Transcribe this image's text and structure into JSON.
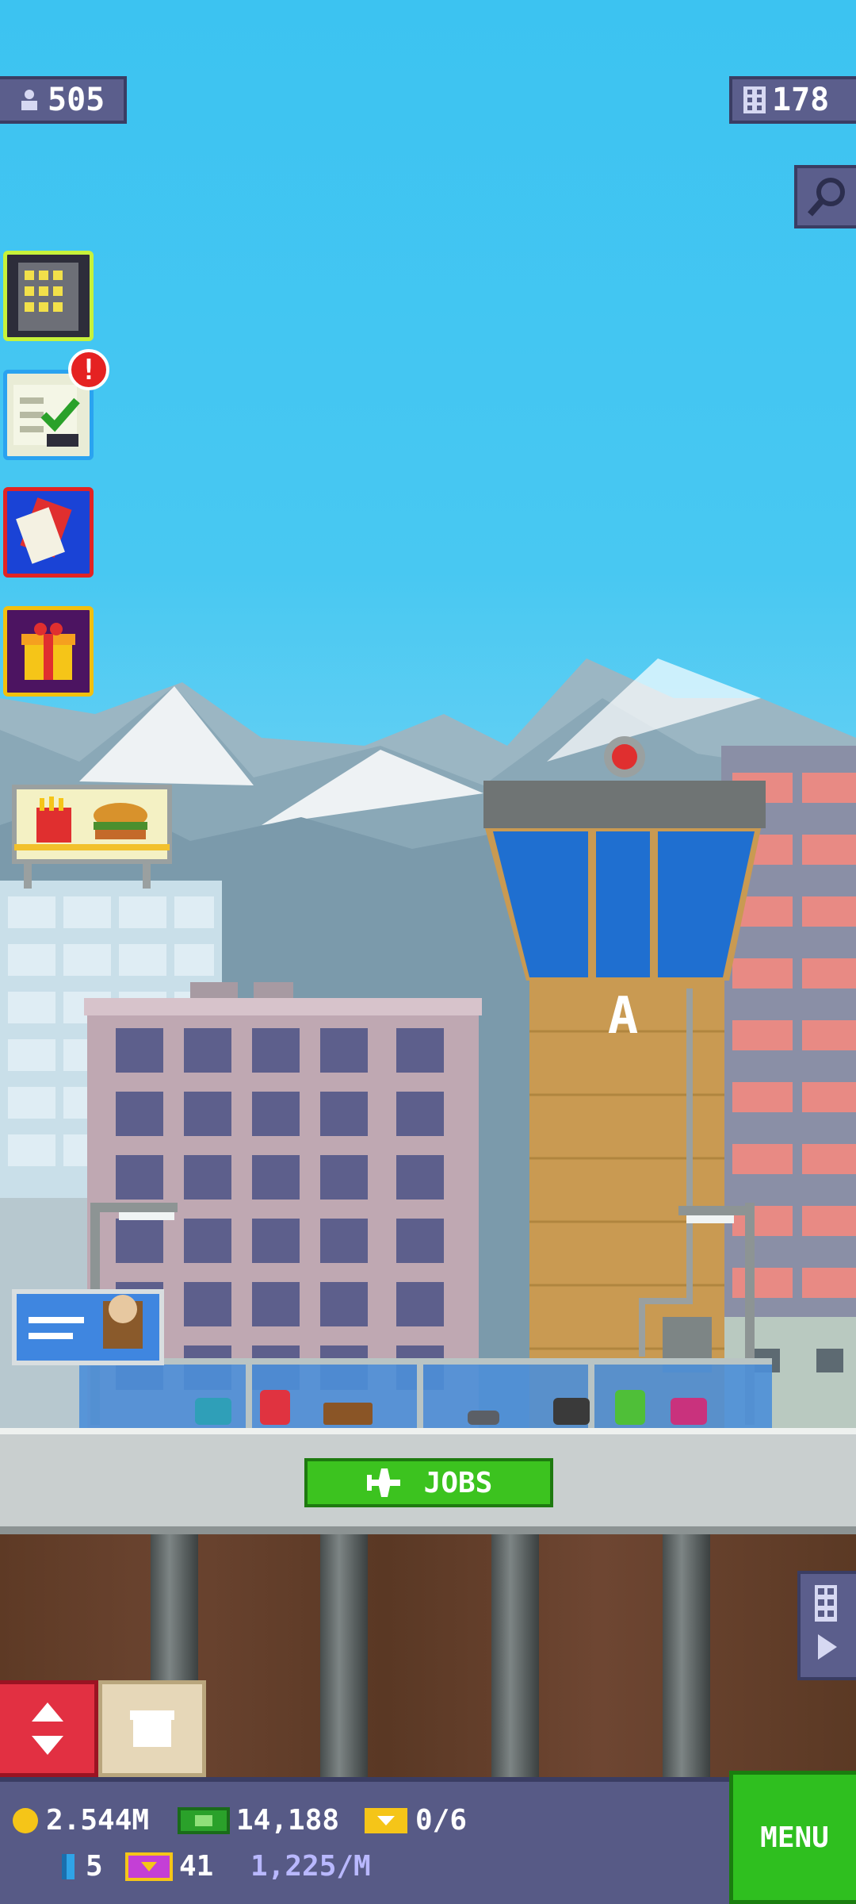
{
  "hud": {
    "population": "505",
    "floors": "178"
  },
  "left_column": {
    "build_icon": "building-icon",
    "missions_icon": "checklist-icon",
    "missions_badge": "!",
    "cards_icon": "cards-icon",
    "gift_icon": "gift-icon"
  },
  "scene": {
    "tower_letter": "A"
  },
  "jobs_button": {
    "label": "JOBS",
    "icon": "airplane-icon"
  },
  "bottom": {
    "coins": "2.544M",
    "bux": "14,188",
    "tickets": "0/6",
    "keys": "5",
    "vip": "41",
    "rate": "1,225/M",
    "menu_label": "MENU"
  },
  "colors": {
    "sky": "#3cc3f1",
    "hud": "#5b5e8c",
    "jobs_green": "#3cc31f",
    "menu_green": "#2fbf1f",
    "elevator_red": "#e23042"
  }
}
